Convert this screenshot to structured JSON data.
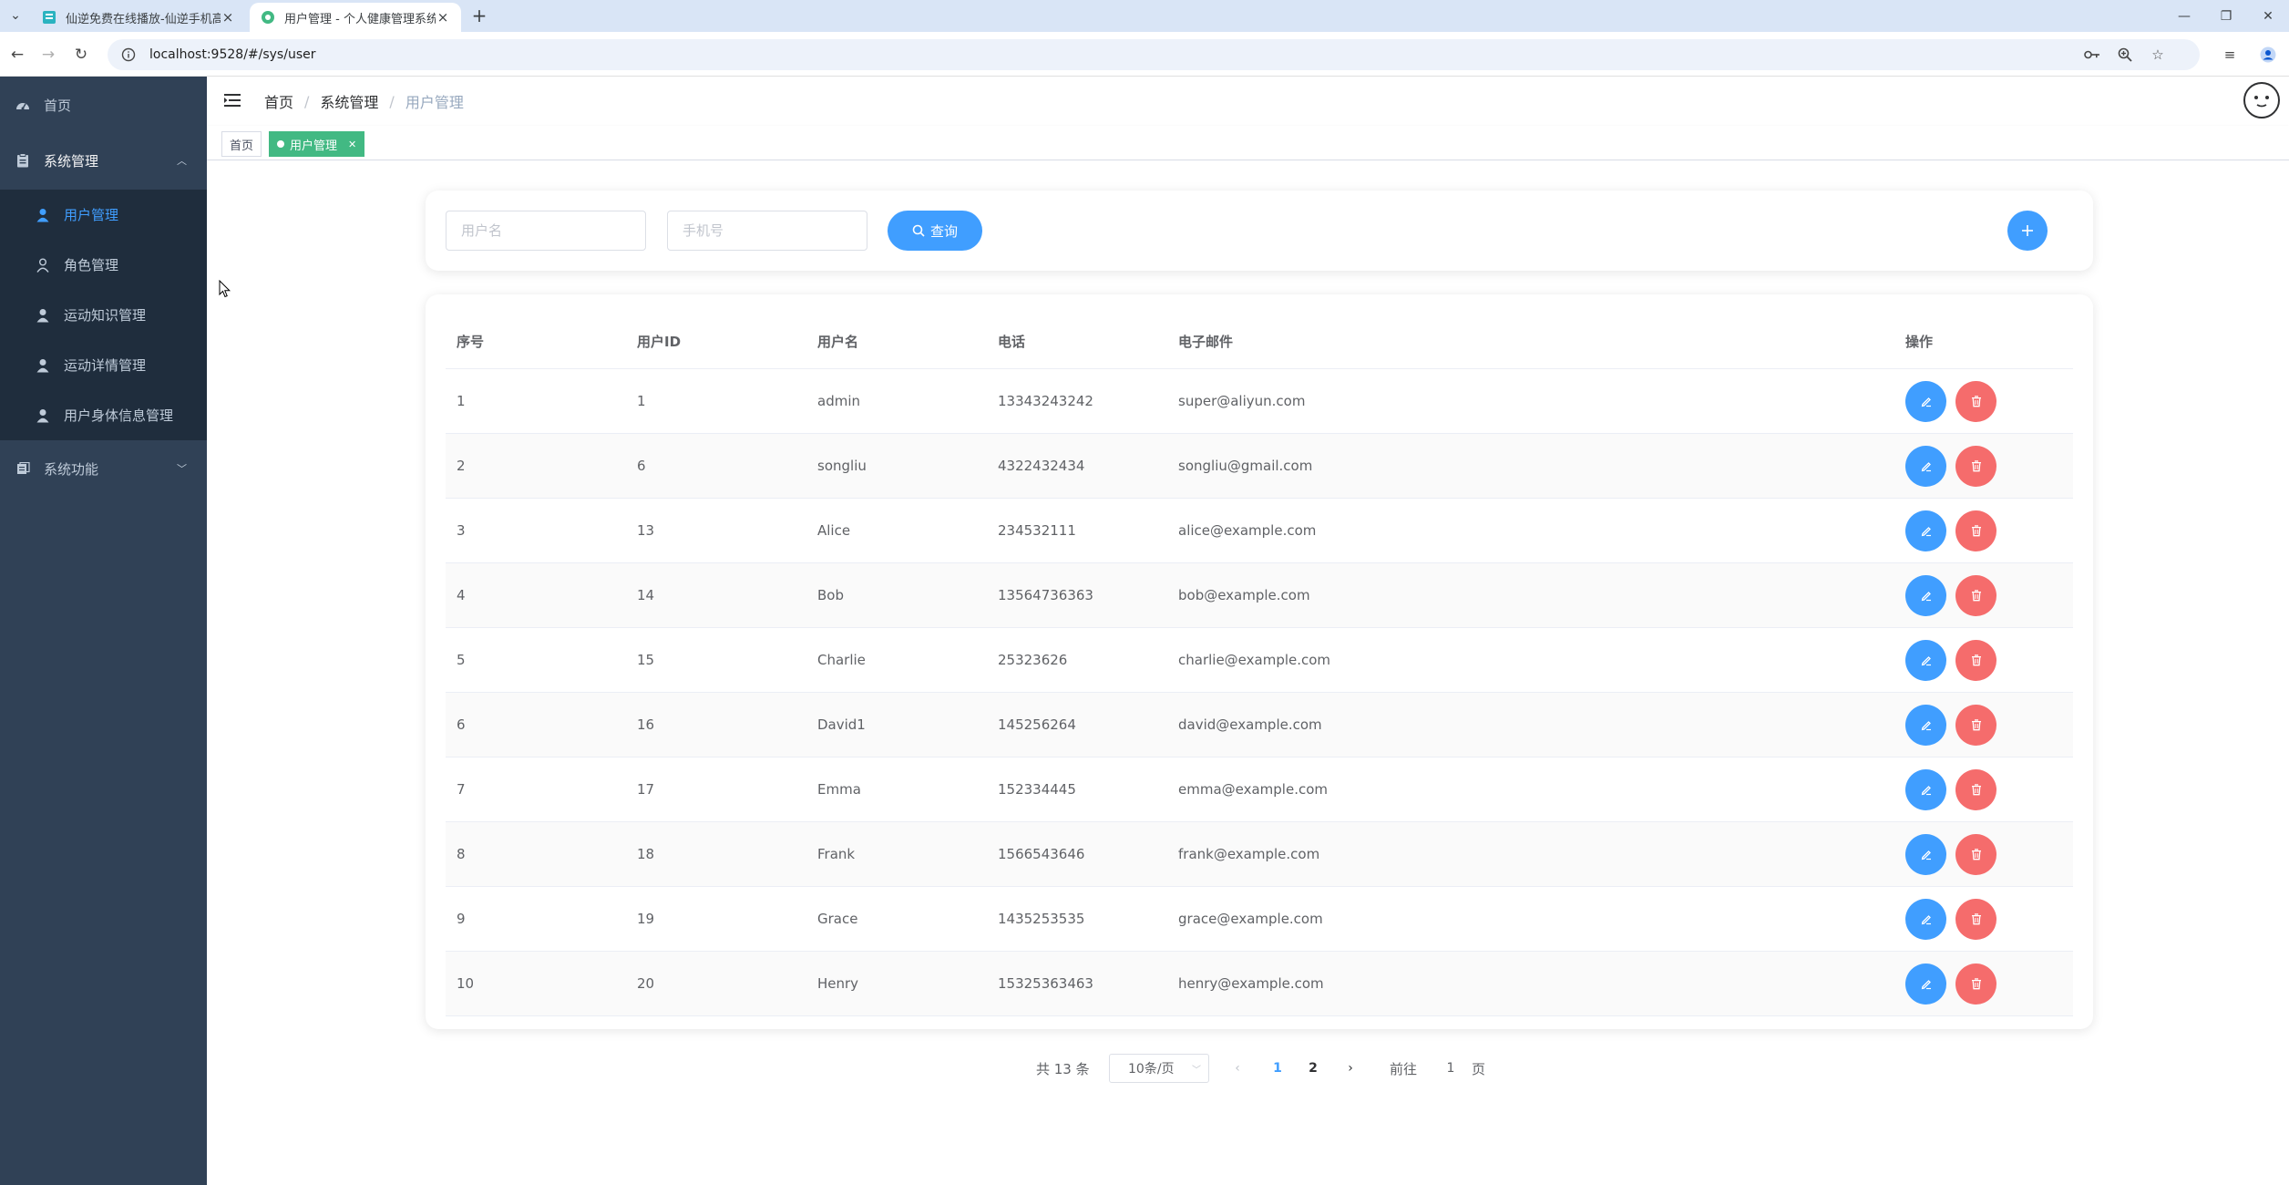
{
  "browser": {
    "tabs": [
      {
        "title": "仙逆免费在线播放-仙逆手机高清",
        "active": false
      },
      {
        "title": "用户管理 - 个人健康管理系统",
        "active": true
      }
    ],
    "url": "localhost:9528/#/sys/user"
  },
  "sidebar": {
    "items": [
      {
        "label": "首页",
        "icon": "dashboard-icon"
      },
      {
        "label": "系统管理",
        "icon": "clipboard-icon",
        "expanded": true
      },
      {
        "label": "系统功能",
        "icon": "documents-icon",
        "expanded": false
      }
    ],
    "submenu": [
      {
        "label": "用户管理",
        "active": true
      },
      {
        "label": "角色管理"
      },
      {
        "label": "运动知识管理"
      },
      {
        "label": "运动详情管理"
      },
      {
        "label": "用户身体信息管理"
      }
    ]
  },
  "header": {
    "breadcrumb": [
      "首页",
      "系统管理",
      "用户管理"
    ]
  },
  "tags": {
    "home": "首页",
    "active": "用户管理"
  },
  "search": {
    "username_placeholder": "用户名",
    "phone_placeholder": "手机号",
    "query_label": "查询"
  },
  "table": {
    "columns": [
      "序号",
      "用户ID",
      "用户名",
      "电话",
      "电子邮件",
      "操作"
    ],
    "rows": [
      {
        "no": "1",
        "id": "1",
        "username": "admin",
        "phone": "13343243242",
        "email": "super@aliyun.com"
      },
      {
        "no": "2",
        "id": "6",
        "username": "songliu",
        "phone": "4322432434",
        "email": "songliu@gmail.com"
      },
      {
        "no": "3",
        "id": "13",
        "username": "Alice",
        "phone": "234532111",
        "email": "alice@example.com"
      },
      {
        "no": "4",
        "id": "14",
        "username": "Bob",
        "phone": "13564736363",
        "email": "bob@example.com"
      },
      {
        "no": "5",
        "id": "15",
        "username": "Charlie",
        "phone": "25323626",
        "email": "charlie@example.com"
      },
      {
        "no": "6",
        "id": "16",
        "username": "David1",
        "phone": "145256264",
        "email": "david@example.com"
      },
      {
        "no": "7",
        "id": "17",
        "username": "Emma",
        "phone": "152334445",
        "email": "emma@example.com"
      },
      {
        "no": "8",
        "id": "18",
        "username": "Frank",
        "phone": "1566543646",
        "email": "frank@example.com"
      },
      {
        "no": "9",
        "id": "19",
        "username": "Grace",
        "phone": "1435253535",
        "email": "grace@example.com"
      },
      {
        "no": "10",
        "id": "20",
        "username": "Henry",
        "phone": "15325363463",
        "email": "henry@example.com"
      }
    ]
  },
  "pagination": {
    "total": "共 13 条",
    "page_size": "10条/页",
    "pages": [
      "1",
      "2"
    ],
    "current": "1",
    "goto_label": "前往",
    "goto_value": "1",
    "page_suffix": "页"
  },
  "colors": {
    "sidebar_bg": "#304156",
    "submenu_bg": "#1f2d3d",
    "primary": "#409eff",
    "danger": "#f56c6c",
    "tag_active": "#42b983"
  }
}
